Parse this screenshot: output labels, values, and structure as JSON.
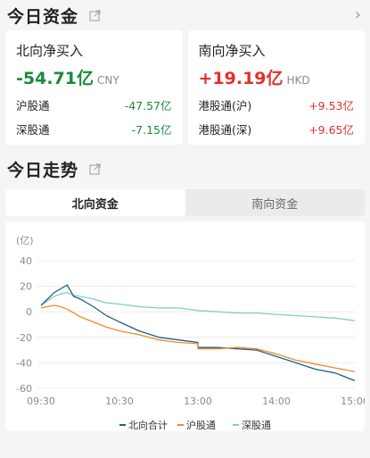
{
  "section1": {
    "title": "今日资金",
    "chevron": "›"
  },
  "north_card": {
    "title": "北向净买入",
    "value": "-54.71亿",
    "unit": "CNY",
    "rows": [
      {
        "label": "沪股通",
        "value": "-47.57亿"
      },
      {
        "label": "深股通",
        "value": "-7.15亿"
      }
    ]
  },
  "south_card": {
    "title": "南向净买入",
    "value": "+19.19亿",
    "unit": "HKD",
    "rows": [
      {
        "label": "港股通(沪)",
        "value": "+9.53亿"
      },
      {
        "label": "港股通(深)",
        "value": "+9.65亿"
      }
    ]
  },
  "section2": {
    "title": "今日走势"
  },
  "tabs": [
    {
      "label": "北向资金",
      "active": true
    },
    {
      "label": "南向资金",
      "active": false
    }
  ],
  "colors": {
    "north_total": "#1f5f8b",
    "sh": "#f08a24",
    "sz": "#7ecfc6",
    "negative": "#1a8a3a",
    "positive": "#e0312d"
  },
  "chart_data": {
    "type": "line",
    "ylabel": "(亿)",
    "ylim": [
      -60,
      40
    ],
    "yticks": [
      40,
      20,
      0,
      -20,
      -40,
      -60
    ],
    "x_labels": [
      "09:30",
      "10:30",
      "13:00",
      "14:00",
      "15:00"
    ],
    "x": [
      "09:30",
      "09:40",
      "09:45",
      "09:50",
      "09:55",
      "10:00",
      "10:10",
      "10:20",
      "10:30",
      "10:45",
      "11:00",
      "11:15",
      "11:30",
      "13:00",
      "13:15",
      "13:30",
      "13:45",
      "14:00",
      "14:15",
      "14:30",
      "14:45",
      "15:00"
    ],
    "series": [
      {
        "name": "北向合计",
        "color": "#1f5f8b",
        "values": [
          5,
          15,
          18,
          21,
          12,
          10,
          4,
          -3,
          -8,
          -15,
          -20,
          -22,
          -24,
          -28,
          -28,
          -29,
          -30,
          -35,
          -40,
          -45,
          -48,
          -54
        ]
      },
      {
        "name": "沪股通",
        "color": "#f08a24",
        "values": [
          3,
          5,
          4,
          2,
          -1,
          -4,
          -8,
          -12,
          -15,
          -18,
          -22,
          -24,
          -25,
          -29,
          -29,
          -28,
          -29,
          -33,
          -38,
          -41,
          -44,
          -47
        ]
      },
      {
        "name": "深股通",
        "color": "#7ecfc6",
        "values": [
          5,
          12,
          14,
          15,
          13,
          12,
          10,
          7,
          6,
          4,
          3,
          3,
          1,
          1,
          0,
          -1,
          -1,
          -2,
          -3,
          -4,
          -5,
          -7
        ]
      }
    ],
    "legend_position": "bottom",
    "grid": true
  }
}
